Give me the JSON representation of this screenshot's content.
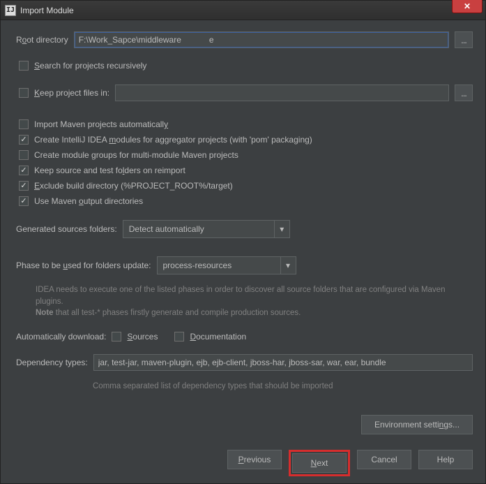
{
  "window": {
    "title": "Import Module"
  },
  "root_dir": {
    "label_pre": "R",
    "label_u": "o",
    "label_post": "ot directory",
    "value": "F:\\Work_Sapce\\middleware            e",
    "browse": "..."
  },
  "search_recursive": {
    "pre": "",
    "u": "S",
    "post": "earch for projects recursively",
    "checked": false
  },
  "keep_files": {
    "pre": "",
    "u": "K",
    "post": "eep project files in:",
    "checked": false,
    "browse": "..."
  },
  "opts": [
    {
      "pre": "Import Maven projects automaticall",
      "u": "y",
      "post": "",
      "checked": false
    },
    {
      "pre": "Create IntelliJ IDEA ",
      "u": "m",
      "post": "odules for aggregator projects (with 'pom' packaging)",
      "checked": true
    },
    {
      "pre": "Create module ",
      "u": "g",
      "post": "roups for multi-module Maven projects",
      "checked": false
    },
    {
      "pre": "Keep source and test fo",
      "u": "l",
      "post": "ders on reimport",
      "checked": true
    },
    {
      "pre": "",
      "u": "E",
      "post": "xclude build directory (%PROJECT_ROOT%/target)",
      "checked": true
    },
    {
      "pre": "Use Maven ",
      "u": "o",
      "post": "utput directories",
      "checked": true
    }
  ],
  "gen_src": {
    "label": "Generated sources folders:",
    "value": "Detect automatically"
  },
  "phase": {
    "label_pre": "Phase to be ",
    "label_u": "u",
    "label_post": "sed for folders update:",
    "value": "process-resources",
    "hint_line1": "IDEA needs to execute one of the listed phases in order to discover all source folders that are configured via Maven plugins.",
    "hint_note": "Note",
    "hint_line2": " that all test-* phases firstly generate and compile production sources."
  },
  "auto_dl": {
    "label": "Automatically download:",
    "sources": {
      "pre": "",
      "u": "S",
      "post": "ources",
      "checked": false
    },
    "docs": {
      "pre": "",
      "u": "D",
      "post": "ocumentation",
      "checked": false
    }
  },
  "dep_types": {
    "label": "Dependency types:",
    "value": "jar, test-jar, maven-plugin, ejb, ejb-client, jboss-har, jboss-sar, war, ear, bundle",
    "hint": "Comma separated list of dependency types that should be imported"
  },
  "env_settings": {
    "pre": "Environment setti",
    "u": "n",
    "post": "gs..."
  },
  "buttons": {
    "previous": {
      "pre": "",
      "u": "P",
      "post": "revious"
    },
    "next": {
      "pre": "",
      "u": "N",
      "post": "ext"
    },
    "cancel": "Cancel",
    "help": "Help"
  }
}
